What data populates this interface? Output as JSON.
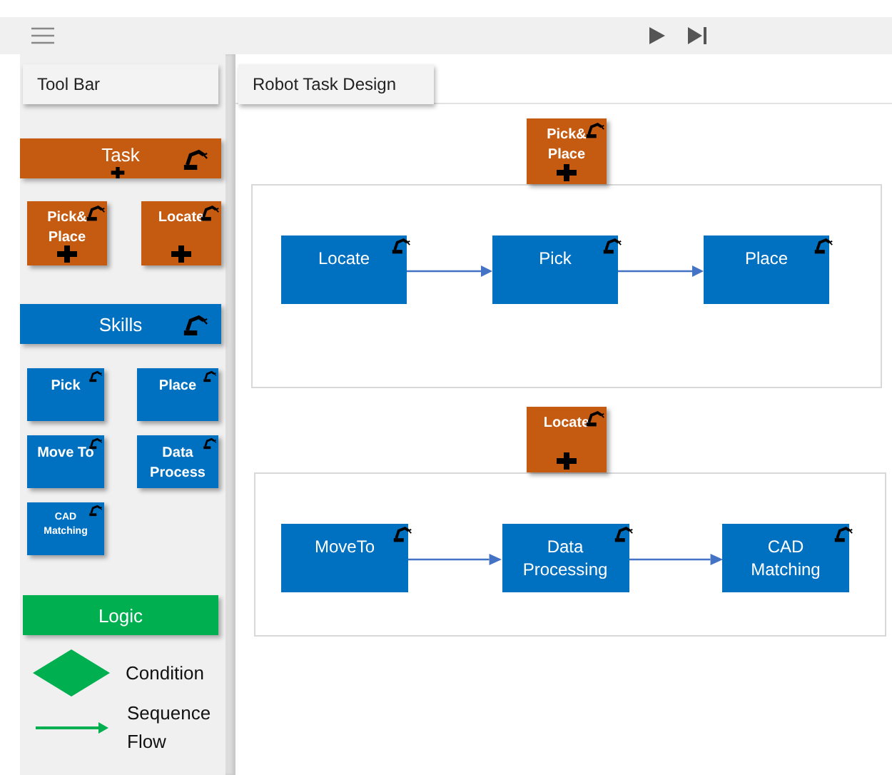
{
  "toolbar": {
    "title": "Tool Bar",
    "sections": [
      {
        "kind": "task",
        "title": "Task",
        "items": [
          {
            "label": "Pick& Place"
          },
          {
            "label": "Locate"
          }
        ]
      },
      {
        "kind": "skill",
        "title": "Skills",
        "items": [
          {
            "label": "Pick"
          },
          {
            "label": "Place"
          },
          {
            "label": "Move To"
          },
          {
            "label": "Data Process"
          },
          {
            "label": "CAD Matching"
          }
        ]
      },
      {
        "kind": "logic",
        "title": "Logic",
        "items": [
          {
            "kind": "condition",
            "label": "Condition"
          },
          {
            "kind": "sequence_flow",
            "label": "Sequence Flow"
          }
        ]
      }
    ]
  },
  "canvas": {
    "title": "Robot Task Design",
    "groups": [
      {
        "task": "Pick& Place",
        "nodes": [
          {
            "label": "Locate"
          },
          {
            "label": "Pick"
          },
          {
            "label": "Place"
          }
        ]
      },
      {
        "task": "Locate",
        "nodes": [
          {
            "label": "MoveTo"
          },
          {
            "label": "Data Processing"
          },
          {
            "label": "CAD Matching"
          }
        ]
      }
    ]
  }
}
